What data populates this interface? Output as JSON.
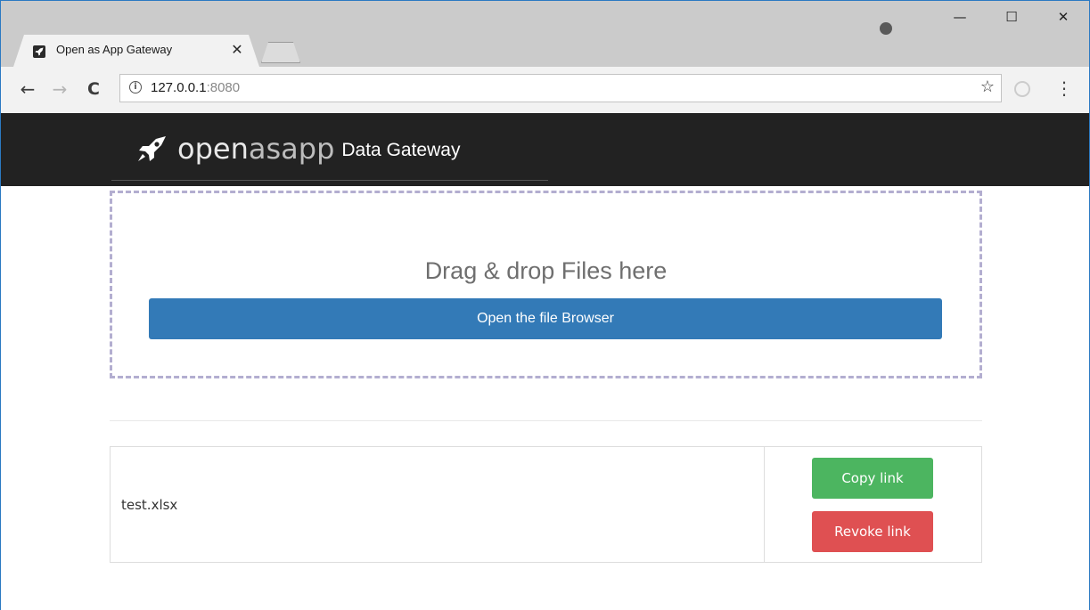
{
  "browser": {
    "tab_title": "Open as App Gateway",
    "tab_close": "✕",
    "url_host": "127.0.0.1",
    "url_port": ":8080",
    "controls": {
      "minimize": "—",
      "maximize": "☐",
      "close": "✕"
    },
    "nav": {
      "back": "←",
      "forward": "→",
      "reload": "C"
    },
    "star": "☆",
    "menu": "⋮",
    "info": "i"
  },
  "app": {
    "brand_word_a": "open",
    "brand_word_b": "asapp",
    "brand_subtitle": "Data Gateway"
  },
  "dropzone": {
    "title": "Drag & drop Files here",
    "browse_label": "Open the file Browser"
  },
  "files": [
    {
      "name": "test.xlsx",
      "copy_label": "Copy link",
      "revoke_label": "Revoke link"
    }
  ],
  "colors": {
    "navbar": "#222222",
    "primary": "#337ab7",
    "success": "#4cb560",
    "danger": "#df5052",
    "dropzone_border": "#b3aed0"
  }
}
